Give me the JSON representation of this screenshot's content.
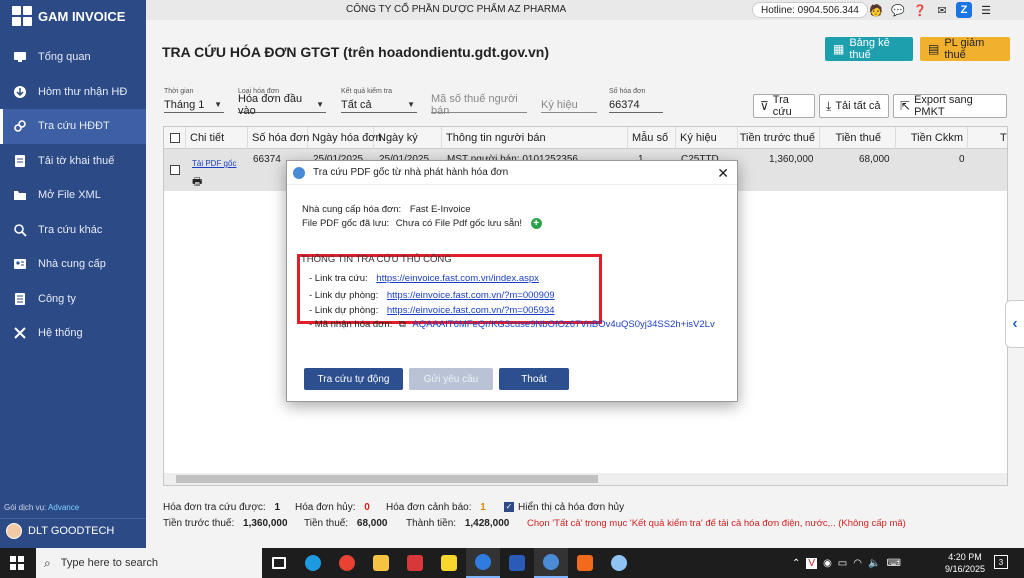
{
  "app": {
    "name": "GAM INVOICE"
  },
  "sidebar": {
    "items": [
      {
        "label": "Tổng quan",
        "icon": "monitor-icon"
      },
      {
        "label": "Hòm thư nhận HĐ",
        "icon": "inbox-icon"
      },
      {
        "label": "Tra cứu HĐĐT",
        "icon": "link-icon"
      },
      {
        "label": "Tải tờ khai thuế",
        "icon": "document-icon"
      },
      {
        "label": "Mở File XML",
        "icon": "folder-icon"
      },
      {
        "label": "Tra cứu khác",
        "icon": "search-icon"
      },
      {
        "label": "Nhà cung cấp",
        "icon": "contact-card-icon"
      },
      {
        "label": "Công ty",
        "icon": "company-icon"
      },
      {
        "label": "Hệ thống",
        "icon": "tools-icon"
      }
    ],
    "service_label": "Gói dịch vụ:",
    "service_value": "Advance",
    "user": "DLT GOODTECH"
  },
  "topbar": {
    "company": "CÔNG TY CỔ PHẦN DƯỢC PHẨM AZ PHARMA",
    "hotline": "Hotline: 0904.506.344"
  },
  "page": {
    "title": "TRA CỨU HÓA ĐƠN GTGT (trên hoadondientu.gdt.gov.vn)",
    "btn_bangke": "Bảng kê thuế",
    "btn_pl": "PL giảm thuế"
  },
  "filters": {
    "time_label": "Thời gian",
    "time_value": "Tháng 1",
    "type_label": "Loại hóa đơn",
    "type_value": "Hóa đơn đầu vào",
    "result_label": "Kết quả kiểm tra",
    "result_value": "Tất cả",
    "tax_placeholder": "Mã số thuế người bán",
    "symbol_placeholder": "Ký hiệu",
    "number_label": "Số hóa đơn",
    "number_value": "66374"
  },
  "toolbar": {
    "search": "Tra cứu",
    "download_all": "Tải tất cả",
    "export": "Export sang PMKT"
  },
  "table": {
    "columns": [
      "Chi tiết",
      "Số hóa đơn",
      "Ngày hóa đơn",
      "Ngày ký",
      "Thông tin người bán",
      "Mẫu số",
      "Ký hiệu",
      "Tiền trước thuế",
      "Tiền thuế",
      "Tiền Ckkm",
      "Tiền"
    ],
    "row": {
      "link": "Tải PDF gốc",
      "number": "66374",
      "date": "25/01/2025",
      "sign_date": "25/01/2025",
      "seller": "MST người bán: 0101252356",
      "form": "1",
      "symbol": "C25TTD",
      "pre_tax": "1,360,000",
      "tax": "68,000",
      "discount": "0"
    }
  },
  "summary": {
    "searched_label": "Hóa đơn tra cứu được:",
    "searched_value": "1",
    "cancelled_label": "Hóa đơn hủy:",
    "cancelled_value": "0",
    "warning_label": "Hóa đơn cảnh báo:",
    "warning_value": "1",
    "show_cancelled": "Hiển thị cả hóa đơn hủy",
    "pre_tax_label": "Tiền trước thuế:",
    "pre_tax_value": "1,360,000",
    "tax_label": "Tiền thuế:",
    "tax_value": "68,000",
    "total_label": "Thành tiền:",
    "total_value": "1,428,000",
    "notice": "Chọn 'Tất cả' trong mục 'Kết quả kiểm tra' để tải cả hóa đơn điện, nước,.. (Không cấp mã)"
  },
  "dialog": {
    "title": "Tra cứu PDF gốc từ nhà phát hành hóa đơn",
    "provider_label": "Nhà cung cấp hóa đơn:",
    "provider_value": "Fast E-Invoice",
    "pdf_label": "File PDF gốc đã lưu:",
    "pdf_value": "Chưa có File Pdf gốc lưu sẵn!",
    "manual_heading": "THÔNG TIN TRA CỨU THỦ CÔNG",
    "lookup_label": "- Link tra cứu:",
    "lookup_url": "https://einvoice.fast.com.vn/index.aspx",
    "backup1_label": "- Link dự phòng:",
    "backup1_url": "https://einvoice.fast.com.vn/?m=000909",
    "backup2_label": "- Link dự phòng:",
    "backup2_url": "https://einvoice.fast.com.vn/?m=005934",
    "code_label": "- Mã nhận hóa đơn:",
    "code_value": "AQAAAIT6MFeQr/KG3cuse9NbOfOz67VnBOv4uQS0yj34SS2h+isV2Lv",
    "btn_auto": "Tra cứu tự động",
    "btn_request": "Gửi yêu cầu",
    "btn_exit": "Thoát"
  },
  "taskbar": {
    "search_placeholder": "Type here to search",
    "time": "4:20 PM",
    "date": "9/16/2025",
    "notif_count": "3"
  }
}
